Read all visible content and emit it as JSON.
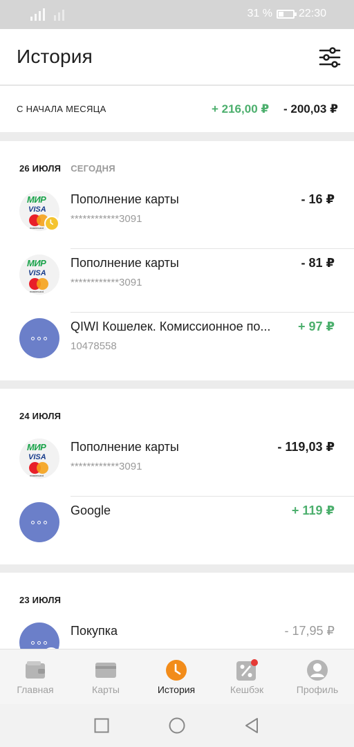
{
  "status_bar": {
    "battery": "31 %",
    "time": "22:30"
  },
  "header": {
    "title": "История",
    "filter_icon": "filter-sliders-icon"
  },
  "summary": {
    "label": "С НАЧАЛА МЕСЯЦА",
    "income": "+ 216,00 ₽",
    "expense": "- 200,03 ₽"
  },
  "groups": [
    {
      "date": "26 ИЮЛЯ",
      "badge": "СЕГОДНЯ",
      "items": [
        {
          "name": "Пополнение карты",
          "sub": "************3091",
          "amount": "- 16 ₽",
          "logo": "mir-visa-mastercard",
          "logo_texts": {
            "mir": "МИР",
            "visa": "VISA",
            "mastercard": "mastercard"
          },
          "badge": "clock-icon"
        },
        {
          "name": "Пополнение карты",
          "sub": "************3091",
          "amount": "- 81 ₽",
          "logo": "mir-visa-mastercard",
          "logo_texts": {
            "mir": "МИР",
            "visa": "VISA",
            "mastercard": "mastercard"
          }
        },
        {
          "name": "QIWI Кошелек. Комиссионное по...",
          "sub": "10478558",
          "amount": "+ 97 ₽",
          "logo": "dots-icon"
        }
      ]
    },
    {
      "date": "24 ИЮЛЯ",
      "items": [
        {
          "name": "Пополнение карты",
          "sub": "************3091",
          "amount": "- 119,03 ₽",
          "logo": "mir-visa-mastercard",
          "logo_texts": {
            "mir": "МИР",
            "visa": "VISA",
            "mastercard": "mastercard"
          }
        },
        {
          "name": "Google",
          "amount": "+ 119 ₽",
          "logo": "dots-icon"
        }
      ]
    },
    {
      "date": "23 ИЮЛЯ",
      "items": [
        {
          "name": "Покупка",
          "amount": "- 17,95 ₽",
          "logo": "dots-icon"
        }
      ]
    }
  ],
  "bottom_nav": [
    {
      "label": "Главная",
      "icon": "wallet-icon"
    },
    {
      "label": "Карты",
      "icon": "card-icon"
    },
    {
      "label": "История",
      "icon": "clock-icon",
      "active": true
    },
    {
      "label": "Кешбэк",
      "icon": "percent-icon",
      "has_badge": true
    },
    {
      "label": "Профиль",
      "icon": "profile-icon"
    }
  ],
  "colors": {
    "positive": "#4caf6d",
    "accent": "#f28c1a",
    "dots_avatar": "#6b7fc9",
    "badge_red": "#e53935"
  }
}
